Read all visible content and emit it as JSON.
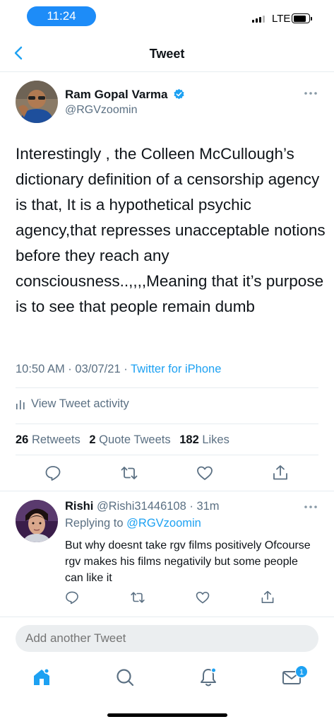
{
  "status_bar": {
    "time": "11:24",
    "network": "LTE"
  },
  "header": {
    "title": "Tweet"
  },
  "tweet": {
    "author_name": "Ram Gopal Varma",
    "author_handle": "@RGVzoomin",
    "text": "Interestingly , the Colleen McCullough’s dictionary definition of a censorship agency is that, It is a hypothetical psychic agency,that represses unacceptable notions before they reach any consciousness..,,,,Meaning that it’s purpose is to see that people remain dumb",
    "time": "10:50 AM",
    "date": "03/07/21",
    "source": "Twitter for iPhone",
    "view_activity": "View Tweet activity",
    "stats": {
      "retweets_count": "26",
      "retweets_label": "Retweets",
      "quotes_count": "2",
      "quotes_label": "Quote Tweets",
      "likes_count": "182",
      "likes_label": "Likes"
    }
  },
  "reply": {
    "author_name": "Rishi",
    "author_handle": "@Rishi31446108",
    "age": "31m",
    "replying_prefix": "Replying to",
    "replying_to": "@RGVzoomin",
    "text": "But why doesnt take rgv films positively Ofcourse rgv makes his films negativily but some people can like it"
  },
  "compose": {
    "placeholder": "Add another Tweet"
  },
  "tab_bar": {
    "messages_badge": "1"
  },
  "colors": {
    "accent": "#1da1f2",
    "time_pill": "#1d8cf8",
    "secondary_text": "#5b7083"
  }
}
